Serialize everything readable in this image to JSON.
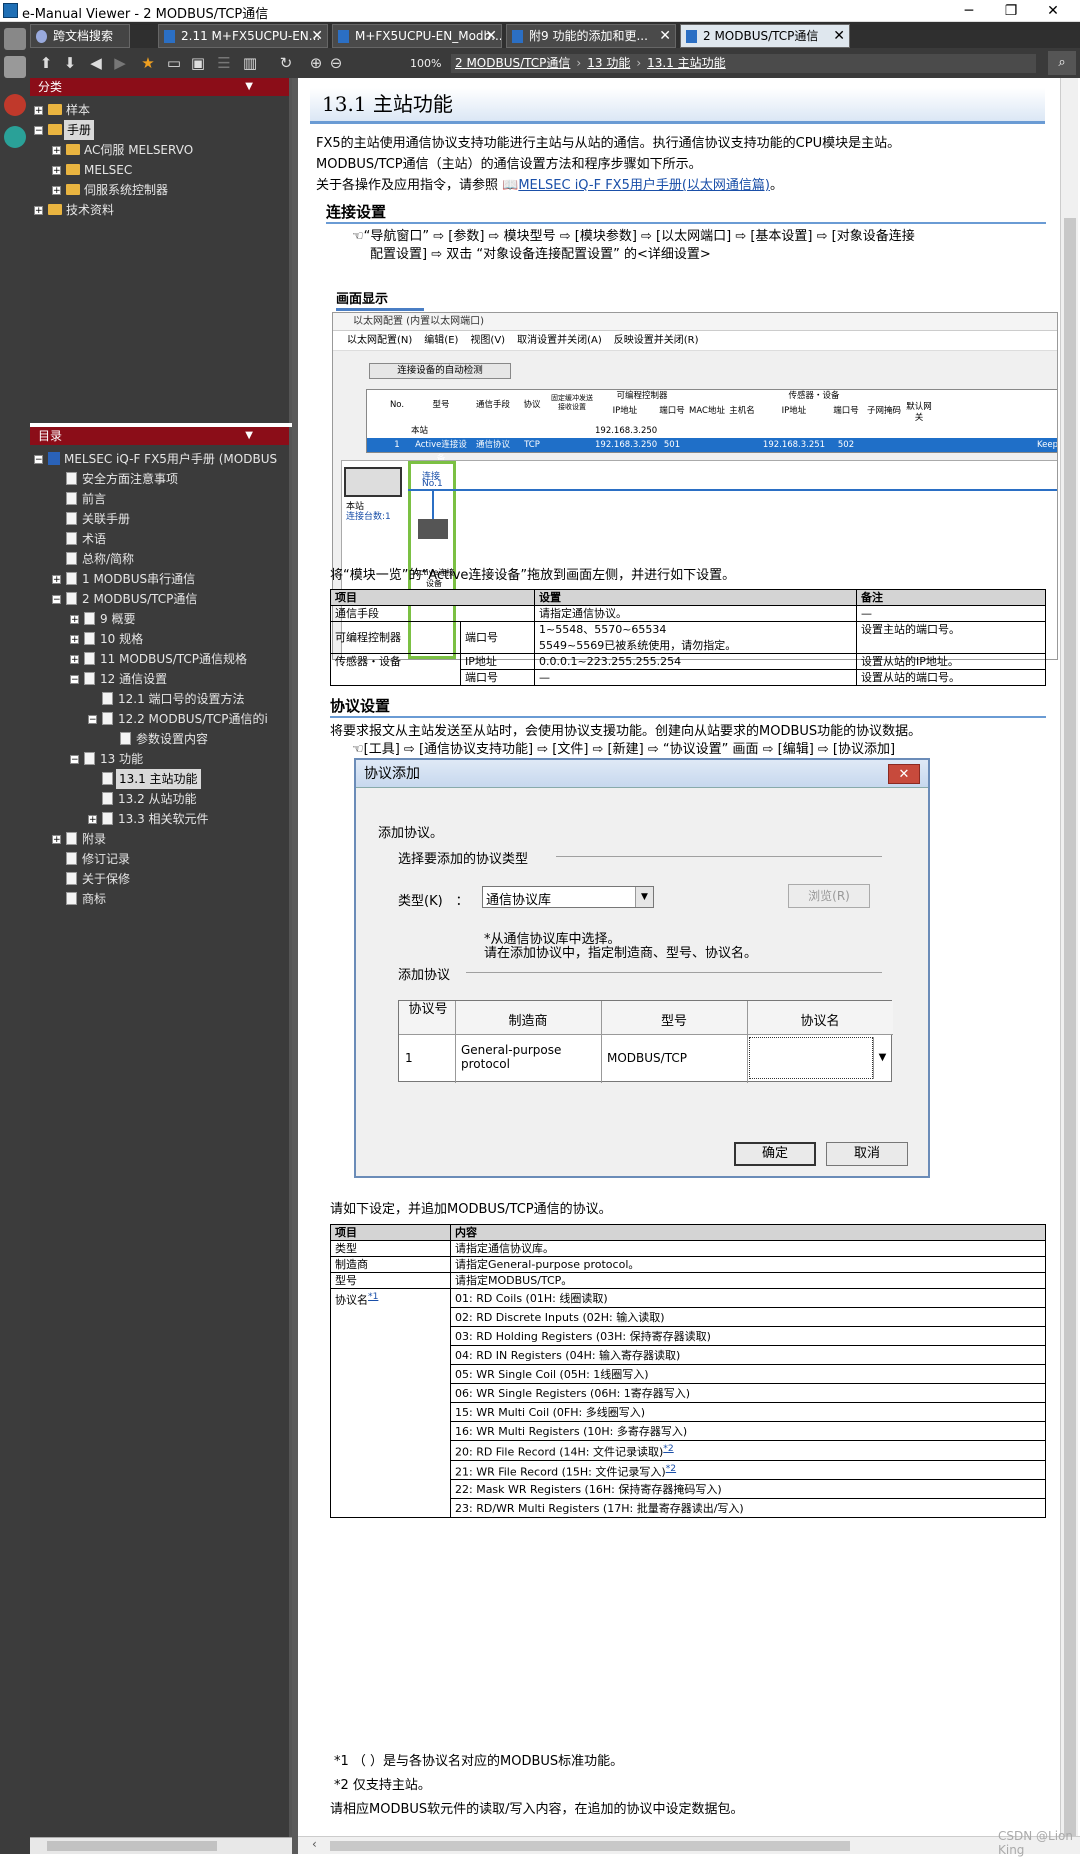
{
  "window": {
    "title": "e-Manual Viewer - 2 MODBUS/TCP通信",
    "minimize": "─",
    "maximize": "❐",
    "close": "✕"
  },
  "tabs": [
    {
      "label": "跨文档搜索"
    },
    {
      "label": "2.11 M+FX5UCPU-EN..."
    },
    {
      "label": "M+FX5UCPU-EN_Modb..."
    },
    {
      "label": "附9 功能的添加和更..."
    },
    {
      "label": "2 MODBUS/TCP通信"
    }
  ],
  "toolbar": {
    "zoom": "100%"
  },
  "breadcrumb": [
    "2 MODBUS/TCP通信",
    "13 功能",
    "13.1 主站功能"
  ],
  "category_panel": {
    "title": "分类",
    "items": [
      {
        "label": "样本",
        "level": 0
      },
      {
        "label": "手册",
        "level": 0
      },
      {
        "label": "AC伺服 MELSERVO",
        "level": 1
      },
      {
        "label": "MELSEC",
        "level": 1
      },
      {
        "label": "伺服系统控制器",
        "level": 1
      },
      {
        "label": "技术资料",
        "level": 0
      }
    ]
  },
  "toc_panel": {
    "title": "目录",
    "items": [
      {
        "label": "MELSEC iQ-F FX5用户手册 (MODBUS"
      },
      {
        "label": "安全方面注意事项"
      },
      {
        "label": "前言"
      },
      {
        "label": "关联手册"
      },
      {
        "label": "术语"
      },
      {
        "label": "总称/简称"
      },
      {
        "label": "1 MODBUS串行通信"
      },
      {
        "label": "2 MODBUS/TCP通信"
      },
      {
        "label": "9 概要"
      },
      {
        "label": "10 规格"
      },
      {
        "label": "11 MODBUS/TCP通信规格"
      },
      {
        "label": "12 通信设置"
      },
      {
        "label": "12.1 端口号的设置方法"
      },
      {
        "label": "12.2 MODBUS/TCP通信的i"
      },
      {
        "label": "参数设置内容"
      },
      {
        "label": "13 功能"
      },
      {
        "label": "13.1 主站功能"
      },
      {
        "label": "13.2 从站功能"
      },
      {
        "label": "13.3 相关软元件"
      },
      {
        "label": "附录"
      },
      {
        "label": "修订记录"
      },
      {
        "label": "关于保修"
      },
      {
        "label": "商标"
      }
    ]
  },
  "content": {
    "section_title": "13.1  主站功能",
    "intro1": "FX5的主站使用通信协议支持功能进行主站与从站的通信。执行通信协议支持功能的CPU模块是主站。",
    "intro2": "MODBUS/TCP通信（主站）的通信设置方法和程序步骤如下所示。",
    "intro3": "关于各操作及应用指令，请参照",
    "intro3_link": "MELSEC iQ-F FX5用户手册(以太网通信篇)",
    "intro3_end": "。",
    "h_connect": "连接设置",
    "nav1_line1": "“导航窗口” ⇨ [参数] ⇨ 模块型号 ⇨ [模块参数] ⇨ [以太网端口] ⇨ [基本设置] ⇨ [对象设备连接",
    "nav1_line2": "配置设置] ⇨ 双击 “对象设备连接配置设置” 的<详细设置>",
    "screen_label": "画面显示",
    "shot1": {
      "title": "以太网配置 (内置以太网端口)",
      "menu": [
        "以太网配置(N)",
        "编辑(E)",
        "视图(V)",
        "取消设置并关闭(A)",
        "反映设置并关闭(R)"
      ],
      "detect_btn": "连接设备的自动检测",
      "headers": {
        "no": "No.",
        "model": "型号",
        "means": "通信手段",
        "proto": "协议",
        "fixed": "固定缓冲发送接收设置",
        "plc": "可编程控制器",
        "plc_ip": "IP地址",
        "plc_port": "端口号",
        "sensor": "传感器・设备",
        "mac": "MAC地址",
        "host": "主机名",
        "ip": "IP地址",
        "port": "端口号",
        "mask": "子网掩码",
        "gw": "默认网关"
      },
      "row0": {
        "model": "本站",
        "ip": "192.168.3.250"
      },
      "row1": {
        "no": "1",
        "model": "Active连接设备",
        "means": "通信协议",
        "proto": "TCP",
        "ip": "192.168.3.250",
        "port": "501",
        "s_ip": "192.168.3.251",
        "s_port": "502",
        "extra": "Keep"
      },
      "host_label": "本站",
      "host_count": "连接台数:1",
      "conn_label": "连接",
      "conn_no": "No.1",
      "dev_label": "Active连接设备"
    },
    "drag_note": "将“模块一览”的“Active连接设备”拖放到画面左侧，并进行如下设置。",
    "table1": {
      "headers": [
        "项目",
        "设置",
        "备注"
      ],
      "rows": [
        [
          "通信手段",
          "",
          "请指定通信协议。",
          "—"
        ],
        [
          "可编程控制器",
          "端口号",
          "1~5548、5570~65534",
          "设置主站的端口号。"
        ],
        [
          "",
          "",
          "5549~5569已被系统使用，请勿指定。",
          ""
        ],
        [
          "传感器・设备",
          "IP地址",
          "0.0.0.1~223.255.255.254",
          "设置从站的IP地址。"
        ],
        [
          "",
          "端口号",
          "—",
          "设置从站的端口号。"
        ]
      ]
    },
    "h_protocol": "协议设置",
    "proto_intro": "将要求报文从主站发送至从站时，会使用协议支援功能。创建向从站要求的MODBUS功能的协议数据。",
    "nav2": "[工具] ⇨ [通信协议支持功能] ⇨ [文件] ⇨ [新建] ⇨ “协议设置” 画面 ⇨ [编辑] ⇨ [协议添加]",
    "dialog": {
      "title": "协议添加",
      "add_label": "添加协议。",
      "select_type": "选择要添加的协议类型",
      "type_label": "类型(K)　：",
      "type_value": "通信协议库",
      "browse": "浏览(R)",
      "hint1": "*从通信协议库中选择。",
      "hint2": "请在添加协议中，指定制造商、型号、协议名。",
      "add_proto": "添加协议",
      "col_no": "协议号",
      "col_maker": "制造商",
      "col_model": "型号",
      "col_name": "协议名",
      "row_no": "1",
      "row_maker1": "General-purpose",
      "row_maker2": "protocol",
      "row_model": "MODBUS/TCP",
      "ok": "确定",
      "cancel": "取消"
    },
    "set_note": "请如下设定，并追加MODBUS/TCP通信的协议。",
    "table2": {
      "headers": [
        "项目",
        "内容"
      ],
      "rows": [
        [
          "类型",
          "请指定通信协议库。"
        ],
        [
          "制造商",
          "请指定General-purpose protocol。"
        ],
        [
          "型号",
          "请指定MODBUS/TCP。"
        ]
      ],
      "name_label": "协议名",
      "name_sup": "*1",
      "protocols": [
        {
          "text": "01: RD Coils (01H: 线圈读取)",
          "sup": ""
        },
        {
          "text": "02: RD Discrete Inputs (02H: 输入读取)",
          "sup": ""
        },
        {
          "text": "03: RD Holding Registers (03H: 保持寄存器读取)",
          "sup": ""
        },
        {
          "text": "04: RD IN Registers (04H: 输入寄存器读取)",
          "sup": ""
        },
        {
          "text": "05: WR Single Coil (05H: 1线圈写入)",
          "sup": ""
        },
        {
          "text": "06: WR Single Registers (06H: 1寄存器写入)",
          "sup": ""
        },
        {
          "text": "15: WR Multi Coil (0FH: 多线圈写入)",
          "sup": ""
        },
        {
          "text": "16: WR Multi Registers (10H: 多寄存器写入)",
          "sup": ""
        },
        {
          "text": "20: RD File Record (14H: 文件记录读取)",
          "sup": "*2"
        },
        {
          "text": "21: WR File Record (15H: 文件记录写入)",
          "sup": "*2"
        },
        {
          "text": "22: Mask WR Registers (16H: 保持寄存器掩码写入)",
          "sup": ""
        },
        {
          "text": "23: RD/WR Multi Registers (17H: 批量寄存器读出/写入)",
          "sup": ""
        }
      ]
    },
    "fn1": "*1  （ ）是与各协议名对应的MODBUS标准功能。",
    "fn2": "*2  仅支持主站。",
    "fn3": "请相应MODBUS软元件的读取/写入内容，在追加的协议中设定数据包。"
  },
  "watermark": "CSDN @Lion King"
}
